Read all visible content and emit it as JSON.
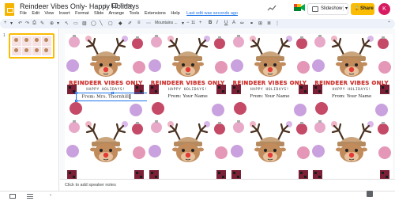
{
  "app": {
    "title": "Reindeer Vibes Only- Happy Holidays",
    "status": "Saving...",
    "menus": [
      "File",
      "Edit",
      "View",
      "Insert",
      "Format",
      "Slide",
      "Arrange",
      "Tools",
      "Extensions",
      "Help"
    ],
    "last_edit": "Last edit was seconds ago",
    "slideshow_label": "Slideshow",
    "share_label": "Share",
    "avatar_initial": "K",
    "accent": "#fbbc04"
  },
  "toolbar": {
    "font": "Mountains ...",
    "font_size": "11",
    "icons": [
      "plus-icon",
      "undo-icon",
      "redo-icon",
      "print-icon",
      "paint-format-icon",
      "zoom-icon",
      "select-icon",
      "textbox-icon",
      "image-icon",
      "shape-icon",
      "line-icon",
      "comment-icon",
      "bold-icon",
      "italic-icon",
      "underline-icon",
      "text-color-icon",
      "highlight-icon",
      "link-icon",
      "align-icon",
      "more-icon"
    ]
  },
  "filmstrip": {
    "slide_number": "1"
  },
  "slide": {
    "card_title": "REINDEER VIBES ONLY",
    "card_greeting": "HAPPY HOLIDAYS!",
    "cards": [
      {
        "from": "From: Mrs. Thornhill"
      },
      {
        "from": "From: Your Name"
      },
      {
        "from": "From: Your Name"
      },
      {
        "from": "From: Your Name"
      },
      {
        "from": ""
      },
      {
        "from": ""
      },
      {
        "from": ""
      },
      {
        "from": ""
      }
    ]
  },
  "notes": {
    "placeholder": "Click to add speaker notes"
  }
}
